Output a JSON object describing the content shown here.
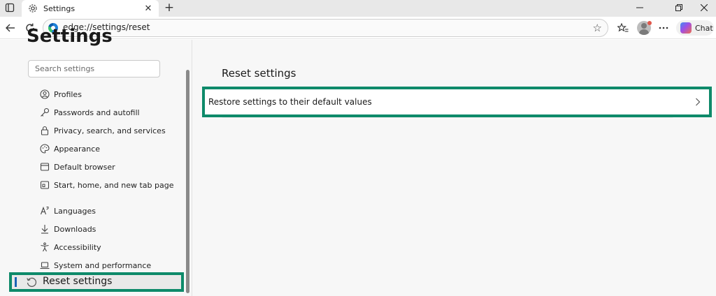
{
  "browser": {
    "tab": {
      "title": "Settings",
      "close": "✕"
    },
    "new_tab": "+",
    "address": {
      "url": "edge://settings/reset"
    },
    "chat_label": "Chat"
  },
  "sidebar": {
    "heading": "Settings",
    "search_placeholder": "Search settings",
    "items": [
      {
        "label": "Profiles",
        "icon": "profile-icon"
      },
      {
        "label": "Passwords and autofill",
        "icon": "key-icon"
      },
      {
        "label": "Privacy, search, and services",
        "icon": "lock-icon"
      },
      {
        "label": "Appearance",
        "icon": "palette-icon"
      },
      {
        "label": "Default browser",
        "icon": "browser-icon"
      },
      {
        "label": "Start, home, and new tab page",
        "icon": "home-icon"
      },
      {
        "label": "Languages",
        "icon": "languages-icon"
      },
      {
        "label": "Downloads",
        "icon": "download-icon"
      },
      {
        "label": "Accessibility",
        "icon": "accessibility-icon"
      },
      {
        "label": "System and performance",
        "icon": "laptop-icon"
      }
    ],
    "active": {
      "label": "Reset settings",
      "icon": "reset-icon"
    }
  },
  "main": {
    "title": "Reset settings",
    "restore_label": "Restore settings to their default values"
  },
  "colors": {
    "highlight": "#0e8a6a",
    "active_indicator": "#1a63b5",
    "content_bg": "#f7f7f7"
  }
}
